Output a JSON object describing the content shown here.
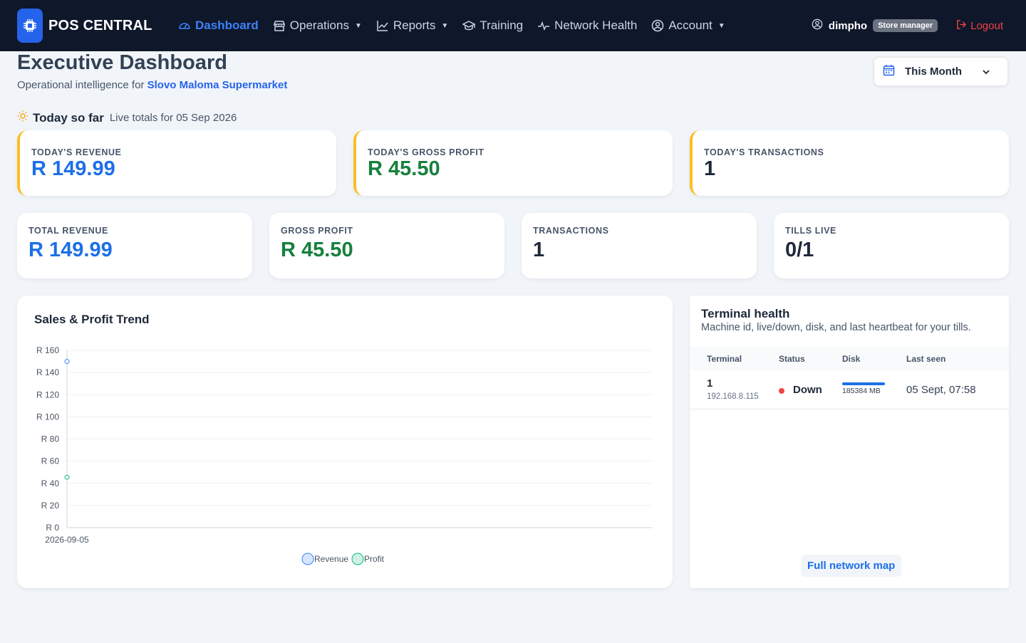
{
  "app": {
    "brand": "POS CENTRAL"
  },
  "nav": {
    "items": [
      {
        "label": "Dashboard",
        "icon": "speedometer-icon",
        "active": true
      },
      {
        "label": "Operations",
        "icon": "shop-icon",
        "dropdown": true
      },
      {
        "label": "Reports",
        "icon": "chart-line-icon",
        "dropdown": true
      },
      {
        "label": "Training",
        "icon": "mortarboard-icon"
      },
      {
        "label": "Network Health",
        "icon": "pulse-icon"
      },
      {
        "label": "Account",
        "icon": "person-circle-icon",
        "dropdown": true
      }
    ],
    "user": "dimpho",
    "role": "Store manager",
    "logout": "Logout"
  },
  "header": {
    "title": "Executive Dashboard",
    "subtitle_prefix": "Operational intelligence for ",
    "store": "Slovo Maloma Supermarket",
    "range": "This Month"
  },
  "today": {
    "title": "Today so far",
    "subtitle": "Live totals for 05 Sep 2026",
    "cards": [
      {
        "label": "TODAY'S REVENUE",
        "value": "R 149.99"
      },
      {
        "label": "TODAY'S GROSS PROFIT",
        "value": "R 45.50"
      },
      {
        "label": "TODAY'S TRANSACTIONS",
        "value": "1"
      }
    ]
  },
  "totals": [
    {
      "label": "TOTAL REVENUE",
      "value": "R 149.99"
    },
    {
      "label": "GROSS PROFIT",
      "value": "R 45.50"
    },
    {
      "label": "TRANSACTIONS",
      "value": "1"
    },
    {
      "label": "TILLS LIVE",
      "value": "0/1"
    }
  ],
  "chart_data": {
    "type": "line",
    "title": "Sales & Profit Trend",
    "x": [
      "2026-09-05"
    ],
    "series": [
      {
        "name": "Revenue",
        "values": [
          149.99
        ],
        "color": "#3b82f6"
      },
      {
        "name": "Profit",
        "values": [
          45.5
        ],
        "color": "#10b981"
      }
    ],
    "ylim": [
      0,
      160
    ],
    "yticks": [
      "R 160",
      "R 140",
      "R 120",
      "R 100",
      "R 80",
      "R 60",
      "R 40",
      "R 20",
      "R 0"
    ],
    "grid": true,
    "legend": "bottom"
  },
  "terminal": {
    "title": "Terminal health",
    "subtitle": "Machine id, live/down, disk, and last heartbeat for your tills.",
    "columns": [
      "Terminal",
      "Status",
      "Disk",
      "Last seen"
    ],
    "rows": [
      {
        "id": "1",
        "ip": "192.168.8.115",
        "status": "Down",
        "disk": "185384 MB",
        "disk_used_fraction": 1.0,
        "last_seen": "05 Sept, 07:58"
      }
    ],
    "link": "Full network map"
  }
}
